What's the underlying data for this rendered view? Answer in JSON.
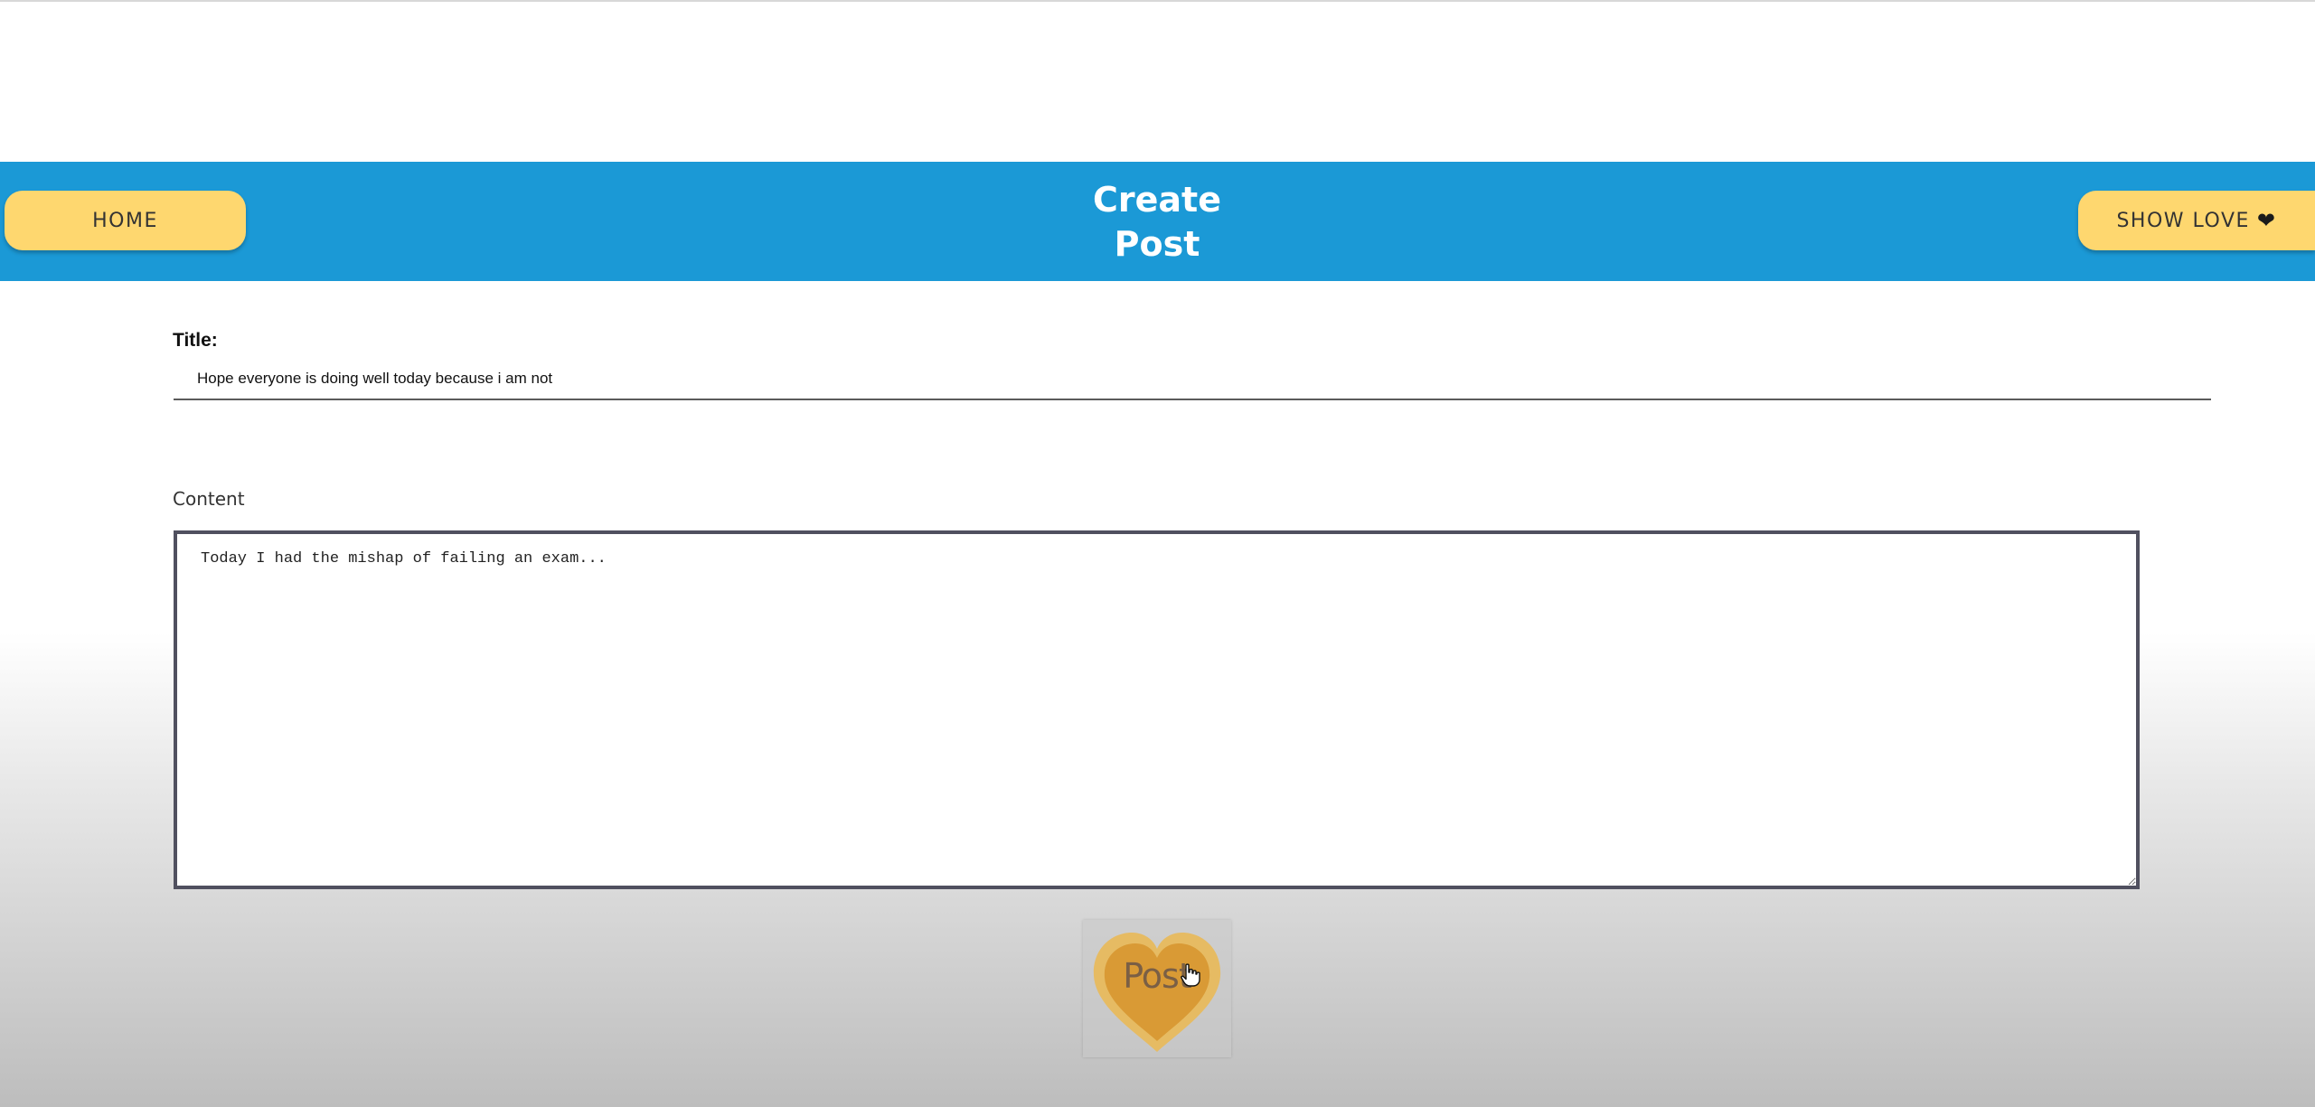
{
  "header": {
    "home_label": "HOME",
    "title_line1": "Create",
    "title_line2": "Post",
    "show_love_label": "SHOW LOVE",
    "show_love_icon": "heart-icon"
  },
  "form": {
    "title_label": "Title:",
    "title_value": "Hope everyone is doing well today because i am not",
    "content_label": "Content",
    "content_value": "Today I had the mishap of failing an exam..."
  },
  "post_button": {
    "label": "Post",
    "icon": "heart-icon"
  },
  "colors": {
    "header_bg": "#1b99d6",
    "button_bg": "#fed76f",
    "heart_outer": "#e0b45a",
    "heart_inner": "#d99a35"
  }
}
